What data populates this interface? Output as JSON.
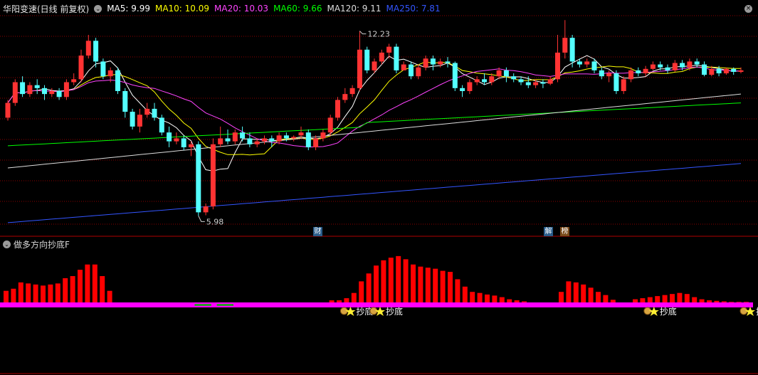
{
  "header": {
    "title": "华阳变速(日线 前复权)",
    "ma": [
      {
        "label": "MA5: 9.99",
        "color": "#ffffff"
      },
      {
        "label": "MA10: 10.09",
        "color": "#ffff00"
      },
      {
        "label": "MA20: 10.03",
        "color": "#ff44ff"
      },
      {
        "label": "MA60: 9.66",
        "color": "#00ff00"
      },
      {
        "label": "MA120: 9.11",
        "color": "#dddddd"
      },
      {
        "label": "MA250: 7.81",
        "color": "#3355ff"
      }
    ]
  },
  "price_panel": {
    "high_label": "12.23",
    "low_label": "5.98",
    "events": [
      {
        "label": "财",
        "color": "#2a5c8a",
        "text_color": "#ffffff"
      },
      {
        "label": "解",
        "color": "#2a5c8a",
        "text_color": "#ffffff"
      },
      {
        "label": "榜",
        "color": "#7a4a1a",
        "text_color": "#ffffff"
      }
    ]
  },
  "indicator": {
    "title": "做多方向抄底F",
    "signal_label": "抄底"
  },
  "icons": {
    "collapse": "chevron-down-icon",
    "close": "close-icon",
    "signal": "money-bag-star-icon"
  },
  "colors": {
    "up": "#ff3333",
    "down": "#54ffff",
    "bar": "#ff0000",
    "base": "#ff00ff",
    "grid": "#8b0000"
  },
  "chart_data": {
    "type": "candlestick",
    "candles": [
      [
        9.3,
        9.8,
        9.9,
        9.2
      ],
      [
        9.8,
        10.5,
        10.6,
        9.7
      ],
      [
        10.5,
        10.1,
        10.7,
        10.0
      ],
      [
        10.1,
        10.4,
        10.5,
        10.0
      ],
      [
        10.4,
        10.3,
        10.6,
        10.1
      ],
      [
        10.3,
        10.1,
        10.4,
        9.9
      ],
      [
        10.1,
        10.2,
        10.3,
        10.0
      ],
      [
        10.2,
        10.0,
        10.3,
        9.9
      ],
      [
        10.0,
        10.5,
        10.6,
        9.9
      ],
      [
        10.5,
        10.6,
        10.8,
        10.4
      ],
      [
        10.6,
        11.4,
        11.6,
        10.5
      ],
      [
        11.4,
        11.9,
        12.1,
        11.3
      ],
      [
        11.9,
        11.2,
        12.0,
        11.0
      ],
      [
        11.2,
        10.7,
        11.3,
        10.6
      ],
      [
        10.7,
        10.9,
        11.0,
        10.5
      ],
      [
        10.9,
        10.2,
        11.0,
        10.1
      ],
      [
        10.2,
        9.5,
        10.3,
        9.3
      ],
      [
        9.5,
        9.0,
        9.6,
        8.9
      ],
      [
        9.0,
        9.4,
        9.6,
        8.8
      ],
      [
        9.4,
        9.6,
        9.8,
        9.3
      ],
      [
        9.6,
        9.3,
        9.8,
        9.2
      ],
      [
        9.3,
        8.8,
        9.4,
        8.7
      ],
      [
        8.8,
        8.5,
        9.0,
        8.3
      ],
      [
        8.5,
        8.6,
        8.8,
        8.4
      ],
      [
        8.6,
        8.3,
        8.7,
        8.2
      ],
      [
        8.3,
        8.4,
        8.5,
        8.0
      ],
      [
        8.4,
        6.1,
        8.5,
        5.98
      ],
      [
        6.1,
        6.3,
        6.4,
        6.0
      ],
      [
        6.3,
        8.4,
        8.6,
        6.2
      ],
      [
        8.4,
        8.6,
        9.0,
        8.3
      ],
      [
        8.6,
        8.5,
        8.9,
        8.4
      ],
      [
        8.5,
        8.8,
        8.9,
        8.4
      ],
      [
        8.8,
        8.6,
        9.0,
        8.5
      ],
      [
        8.6,
        8.4,
        8.8,
        8.3
      ],
      [
        8.4,
        8.5,
        8.6,
        8.3
      ],
      [
        8.5,
        8.6,
        8.7,
        8.4
      ],
      [
        8.6,
        8.5,
        8.7,
        8.3
      ],
      [
        8.5,
        8.7,
        8.8,
        8.4
      ],
      [
        8.7,
        8.6,
        8.8,
        8.5
      ],
      [
        8.6,
        8.65,
        8.7,
        8.5
      ],
      [
        8.7,
        8.8,
        9.0,
        8.6
      ],
      [
        8.8,
        8.3,
        8.9,
        8.2
      ],
      [
        8.3,
        8.6,
        8.7,
        8.2
      ],
      [
        8.6,
        8.8,
        8.9,
        8.5
      ],
      [
        8.8,
        9.3,
        9.4,
        8.7
      ],
      [
        9.3,
        9.9,
        10.0,
        9.2
      ],
      [
        9.9,
        10.1,
        10.3,
        9.8
      ],
      [
        10.1,
        10.3,
        10.4,
        10.0
      ],
      [
        10.3,
        11.6,
        12.23,
        10.2
      ],
      [
        11.6,
        10.9,
        11.7,
        10.8
      ],
      [
        10.9,
        11.2,
        11.3,
        10.8
      ],
      [
        11.2,
        11.5,
        11.6,
        11.1
      ],
      [
        11.5,
        11.7,
        11.8,
        11.3
      ],
      [
        11.7,
        10.9,
        11.8,
        10.8
      ],
      [
        10.9,
        11.1,
        11.2,
        10.9
      ],
      [
        11.1,
        10.7,
        11.2,
        10.6
      ],
      [
        10.7,
        11.0,
        11.1,
        10.6
      ],
      [
        11.0,
        11.3,
        11.4,
        10.9
      ],
      [
        11.3,
        11.1,
        11.4,
        10.9
      ],
      [
        11.1,
        11.2,
        11.3,
        11.0
      ],
      [
        11.2,
        11.15,
        11.35,
        11.0
      ],
      [
        11.15,
        10.3,
        11.2,
        10.2
      ],
      [
        10.3,
        10.2,
        10.4,
        10.0
      ],
      [
        10.2,
        10.5,
        10.6,
        10.1
      ],
      [
        10.5,
        10.6,
        10.7,
        10.4
      ],
      [
        10.6,
        10.5,
        10.8,
        10.4
      ],
      [
        10.5,
        10.7,
        10.8,
        10.4
      ],
      [
        10.7,
        10.9,
        11.0,
        10.6
      ],
      [
        10.9,
        10.7,
        11.0,
        10.5
      ],
      [
        10.7,
        10.6,
        10.8,
        10.5
      ],
      [
        10.6,
        10.5,
        10.7,
        10.4
      ],
      [
        10.5,
        10.4,
        10.7,
        10.3
      ],
      [
        10.4,
        10.5,
        10.6,
        10.3
      ],
      [
        10.5,
        10.45,
        10.6,
        10.3
      ],
      [
        10.45,
        10.6,
        10.7,
        10.4
      ],
      [
        10.6,
        11.5,
        12.1,
        10.5
      ],
      [
        11.5,
        12.0,
        12.6,
        11.3
      ],
      [
        12.0,
        11.2,
        12.1,
        11.0
      ],
      [
        11.2,
        11.1,
        11.3,
        11.0
      ],
      [
        11.1,
        11.2,
        11.3,
        11.0
      ],
      [
        11.2,
        10.9,
        11.3,
        10.8
      ],
      [
        10.9,
        10.7,
        11.0,
        10.6
      ],
      [
        10.7,
        10.8,
        10.9,
        10.5
      ],
      [
        10.8,
        10.2,
        10.9,
        10.1
      ],
      [
        10.2,
        10.6,
        10.7,
        10.1
      ],
      [
        10.6,
        10.9,
        11.0,
        10.5
      ],
      [
        10.9,
        10.8,
        11.0,
        10.7
      ],
      [
        10.8,
        10.95,
        11.05,
        10.7
      ],
      [
        10.95,
        11.1,
        11.2,
        10.9
      ],
      [
        11.1,
        11.0,
        11.2,
        10.9
      ],
      [
        11.0,
        10.9,
        11.1,
        10.8
      ],
      [
        10.9,
        11.15,
        11.25,
        10.85
      ],
      [
        11.15,
        11.0,
        11.25,
        10.9
      ],
      [
        11.0,
        11.2,
        11.3,
        10.9
      ],
      [
        11.2,
        11.1,
        11.3,
        11.0
      ],
      [
        11.1,
        10.75,
        11.2,
        10.7
      ],
      [
        10.75,
        10.95,
        11.05,
        10.7
      ],
      [
        10.95,
        10.8,
        11.05,
        10.7
      ],
      [
        10.8,
        10.95,
        11.0,
        10.75
      ],
      [
        10.95,
        10.85,
        11.0,
        10.75
      ],
      [
        10.85,
        10.9,
        11.0,
        10.8
      ]
    ],
    "ylim": [
      5.7,
      12.75
    ],
    "indicator_values": [
      0.22,
      0.26,
      0.38,
      0.36,
      0.34,
      0.32,
      0.34,
      0.36,
      0.46,
      0.5,
      0.62,
      0.72,
      0.72,
      0.5,
      0.22,
      0,
      0,
      0,
      0,
      0,
      0,
      0,
      0,
      0,
      0,
      0,
      -0.03,
      -0.03,
      0,
      -0.03,
      -0.03,
      0,
      0,
      0,
      0,
      0,
      0,
      0,
      0,
      0,
      0,
      0,
      0,
      0,
      0.04,
      0.04,
      0.08,
      0.18,
      0.4,
      0.55,
      0.7,
      0.8,
      0.85,
      0.88,
      0.82,
      0.72,
      0.68,
      0.66,
      0.64,
      0.6,
      0.58,
      0.44,
      0.3,
      0.2,
      0.18,
      0.15,
      0.13,
      0.1,
      0.06,
      0.04,
      0.02,
      0,
      0,
      0,
      0,
      0.2,
      0.4,
      0.38,
      0.34,
      0.28,
      0.2,
      0.14,
      0.05,
      0,
      0,
      0.06,
      0.08,
      0.1,
      0.12,
      0.14,
      0.16,
      0.18,
      0.16,
      0.1,
      0.06,
      0.04,
      0.03,
      0.02,
      0.01,
      0.01,
      0.01
    ],
    "signal_indices": [
      46,
      50,
      87,
      100
    ]
  }
}
